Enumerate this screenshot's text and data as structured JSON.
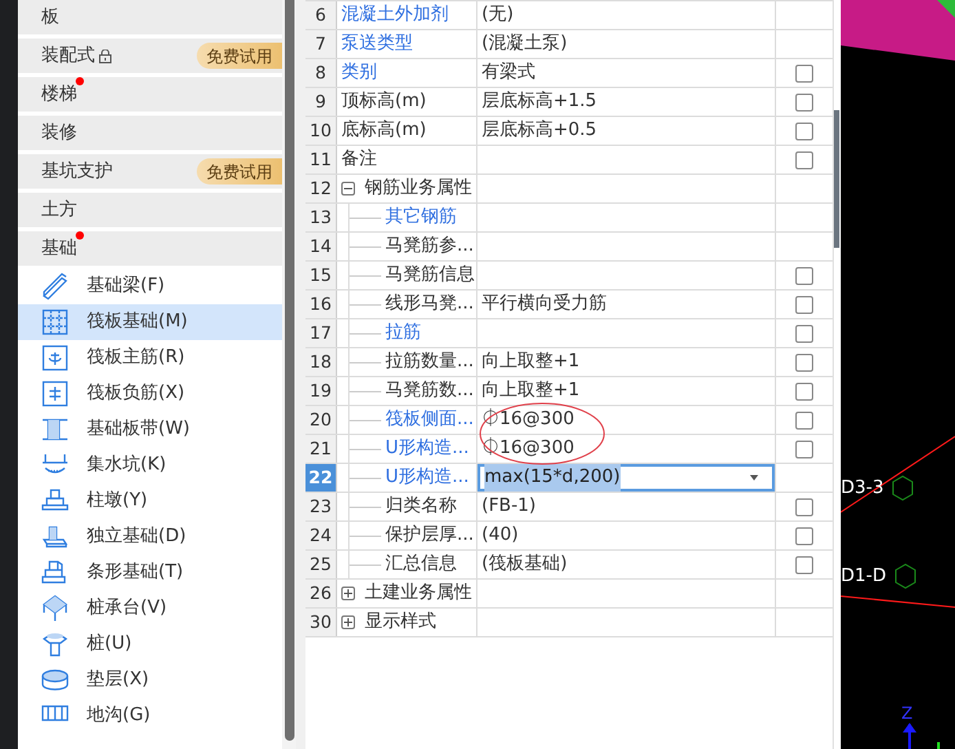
{
  "sidebar": {
    "categories": [
      {
        "label": "板",
        "locked": false,
        "dot": false
      },
      {
        "label": "装配式",
        "badge": "免费试用",
        "locked": true,
        "dot": false
      },
      {
        "label": "楼梯",
        "locked": false,
        "dot": true
      },
      {
        "label": "装修",
        "locked": false,
        "dot": false
      },
      {
        "label": "基坑支护",
        "badge": "免费试用",
        "locked": false,
        "dot": false
      },
      {
        "label": "土方",
        "locked": false,
        "dot": false
      },
      {
        "label": "基础",
        "locked": false,
        "dot": true
      }
    ],
    "items": [
      {
        "label": "基础梁(F)",
        "selected": false
      },
      {
        "label": "筏板基础(M)",
        "selected": true
      },
      {
        "label": "筏板主筋(R)",
        "selected": false
      },
      {
        "label": "筏板负筋(X)",
        "selected": false
      },
      {
        "label": "基础板带(W)",
        "selected": false
      },
      {
        "label": "集水坑(K)",
        "selected": false
      },
      {
        "label": "柱墩(Y)",
        "selected": false
      },
      {
        "label": "独立基础(D)",
        "selected": false
      },
      {
        "label": "条形基础(T)",
        "selected": false
      },
      {
        "label": "桩承台(V)",
        "selected": false
      },
      {
        "label": "桩(U)",
        "selected": false
      },
      {
        "label": "垫层(X)",
        "selected": false
      },
      {
        "label": "地沟(G)",
        "selected": false
      }
    ]
  },
  "properties": {
    "rows": [
      {
        "number": "6",
        "name": "混凝土外加剂",
        "value": "(无)",
        "link": true,
        "selected": false
      },
      {
        "number": "7",
        "name": "泵送类型",
        "value": "(混凝土泵)",
        "link": true,
        "selected": false
      },
      {
        "number": "8",
        "name": "类别",
        "value": "有梁式",
        "link": true,
        "checked": false,
        "selected": false
      },
      {
        "number": "9",
        "name": "顶标高(m)",
        "value": "层底标高+1.5",
        "link": false,
        "checked": false,
        "selected": false
      },
      {
        "number": "10",
        "name": "底标高(m)",
        "value": "层底标高+0.5",
        "link": false,
        "checked": false,
        "selected": false
      },
      {
        "number": "11",
        "name": "备注",
        "link": false,
        "checked": false,
        "selected": false
      },
      {
        "number": "12",
        "name": "钢筋业务属性",
        "link": false,
        "selected": false,
        "expanded": true,
        "children": [
          {
            "number": "13",
            "name": "其它钢筋",
            "link": true,
            "selected": false
          },
          {
            "number": "14",
            "name": "马凳筋参...",
            "link": false,
            "selected": false
          },
          {
            "number": "15",
            "name": "马凳筋信息",
            "link": false,
            "checked": false,
            "selected": false
          },
          {
            "number": "16",
            "name": "线形马凳...",
            "value": "平行横向受力筋",
            "link": false,
            "checked": false,
            "selected": false
          },
          {
            "number": "17",
            "name": "拉筋",
            "link": true,
            "checked": false,
            "selected": false
          },
          {
            "number": "18",
            "name": "拉筋数量...",
            "value": "向上取整+1",
            "link": false,
            "checked": false,
            "selected": false
          },
          {
            "number": "19",
            "name": "马凳筋数...",
            "value": "向上取整+1",
            "link": false,
            "checked": false,
            "selected": false
          },
          {
            "number": "20",
            "name": "筏板侧面...",
            "value": "⏀16@300",
            "link": true,
            "checked": false,
            "selected": false
          },
          {
            "number": "21",
            "name": "U形构造...",
            "value": "⏀16@300",
            "link": true,
            "checked": false,
            "selected": false
          },
          {
            "number": "22",
            "name": "U形构造...",
            "value": "max(15*d,200)",
            "link": true,
            "selected": true
          },
          {
            "number": "23",
            "name": "归类名称",
            "value": "(FB-1)",
            "link": false,
            "checked": false,
            "selected": false
          },
          {
            "number": "24",
            "name": "保护层厚...",
            "value": "(40)",
            "link": false,
            "checked": false,
            "selected": false
          },
          {
            "number": "25",
            "name": "汇总信息",
            "value": "(筏板基础)",
            "link": false,
            "checked": false,
            "selected": false
          }
        ]
      },
      {
        "number": "26",
        "name": "土建业务属性",
        "link": false,
        "selected": false,
        "expanded": false
      },
      {
        "number": "30",
        "name": "显示样式",
        "link": false,
        "selected": false,
        "expanded": false
      }
    ]
  },
  "canvas": {
    "labels": [
      "D3-3",
      "D1-D"
    ],
    "axis_label": "Z"
  }
}
